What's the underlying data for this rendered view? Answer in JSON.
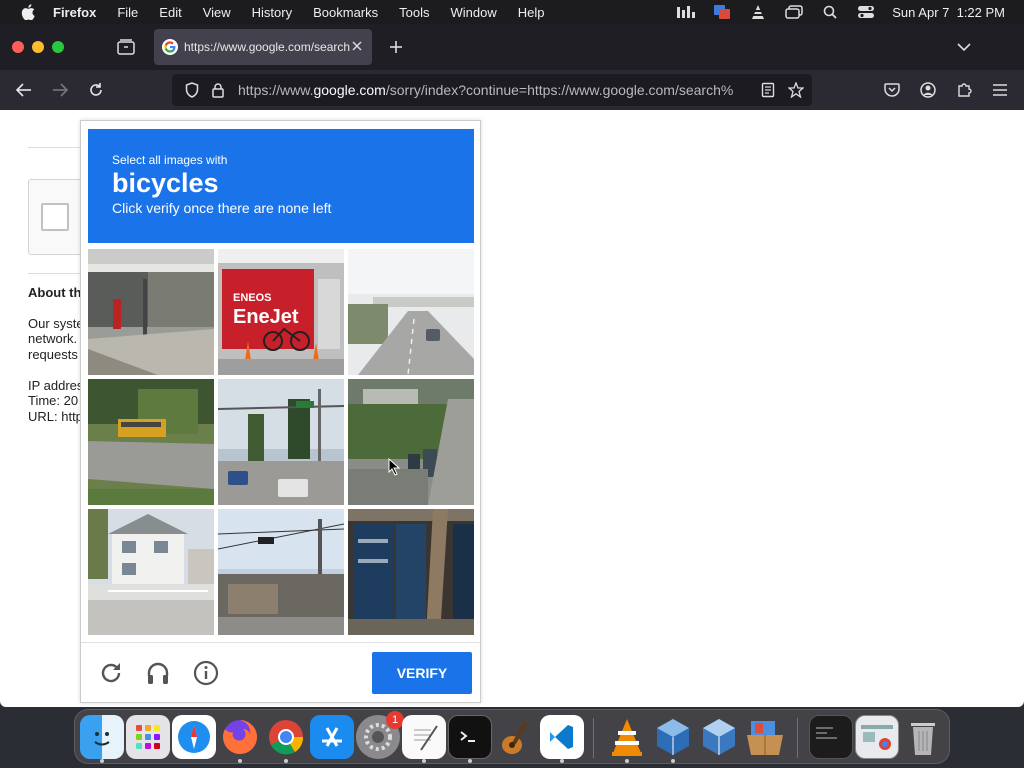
{
  "menubar": {
    "app_name": "Firefox",
    "menus": [
      "File",
      "Edit",
      "View",
      "History",
      "Bookmarks",
      "Tools",
      "Window",
      "Help"
    ],
    "clock": "Sun Apr 7  1:22 PM"
  },
  "browser": {
    "tab_title": "https://www.google.com/search",
    "url_prefix": "https://www.",
    "url_domain": "google.com",
    "url_rest": "/sorry/index?continue=https://www.google.com/search%"
  },
  "page": {
    "about_heading": "About th",
    "lines": [
      "Our syste",
      "network.",
      "requests",
      "IP addres",
      "Time: 20",
      "URL: http"
    ]
  },
  "captcha": {
    "instruction_small": "Select all images with",
    "target_word": "bicycles",
    "instruction_sub": "Click verify once there are none left",
    "verify_label": "VERIFY"
  },
  "dock": {
    "settings_badge": "1"
  },
  "colors": {
    "captcha_blue": "#1a73e8",
    "menubar_bg": "#1c1c1e",
    "tab_active_bg": "#42414d"
  }
}
